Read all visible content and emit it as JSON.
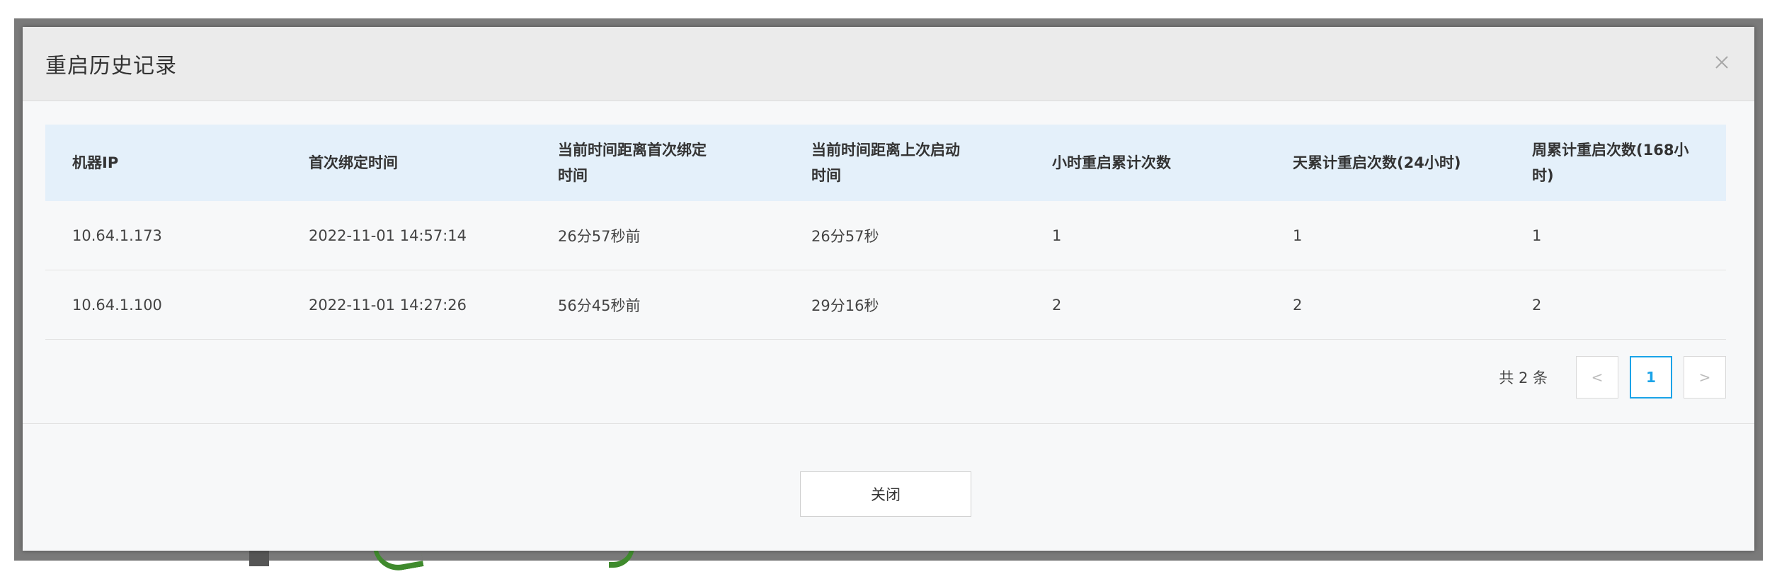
{
  "dialog": {
    "title": "重启历史记录"
  },
  "table": {
    "headers": {
      "ip": "机器IP",
      "first_bind": "首次绑定时间",
      "since_first_bind_line1": "当前时间距离首次绑定",
      "since_first_bind_line2": "时间",
      "since_last_start_line1": "当前时间距离上次启动",
      "since_last_start_line2": "时间",
      "hour_restarts": "小时重启累计次数",
      "day_restarts": "天累计重启次数(24小时)",
      "week_restarts_line1": "周累计重启次数(168小",
      "week_restarts_line2": "时)"
    },
    "rows": [
      {
        "ip": "10.64.1.173",
        "first_bind": "2022-11-01 14:57:14",
        "since_first_bind": "26分57秒前",
        "since_last_start": "26分57秒",
        "hour_restarts": "1",
        "day_restarts": "1",
        "week_restarts": "1"
      },
      {
        "ip": "10.64.1.100",
        "first_bind": "2022-11-01 14:27:26",
        "since_first_bind": "56分45秒前",
        "since_last_start": "29分16秒",
        "hour_restarts": "2",
        "day_restarts": "2",
        "week_restarts": "2"
      }
    ]
  },
  "pagination": {
    "total_text": "共 2 条",
    "current_page": "1",
    "prev_glyph": "<",
    "next_glyph": ">"
  },
  "footer": {
    "close_label": "关闭"
  },
  "colors": {
    "header_bg": "#e4f0fa",
    "active_page": "#1aa3e8"
  }
}
